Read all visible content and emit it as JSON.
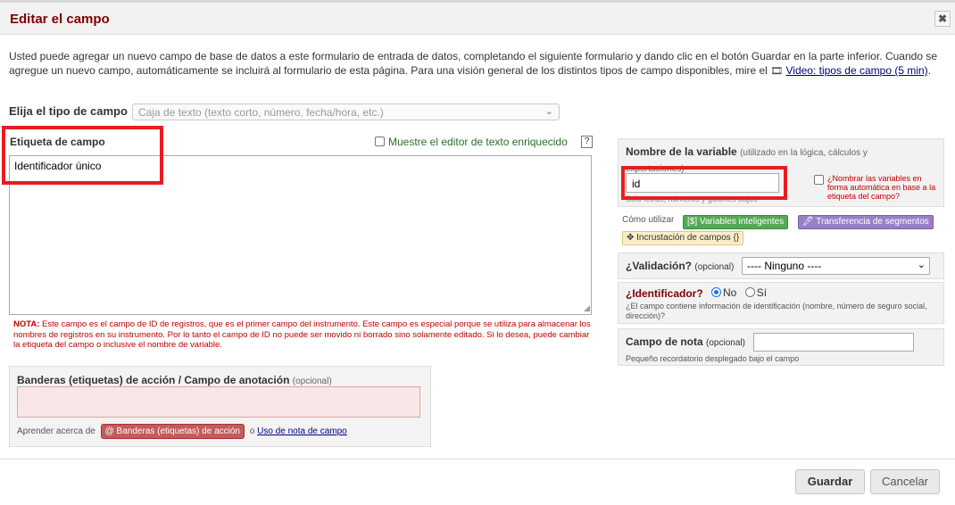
{
  "dialog": {
    "title": "Editar el campo",
    "close_icon": "✖"
  },
  "intro": {
    "text": "Usted puede agregar un nuevo campo de base de datos a este formulario de entrada de datos, completando el siguiente formulario y dando clic en el botón Guardar en la parte inferior. Cuando se agregue un nuevo campo, automáticamente se incluirá al formulario de esta página. Para una visión general de los distintos tipos de campo disponibles, mire el",
    "video_link": "Video: tipos de campo (5 min)",
    "video_icon": "film-icon"
  },
  "field_type": {
    "label": "Elija el tipo de campo",
    "placeholder": "Caja de texto (texto corto, número, fecha/hora, etc.)"
  },
  "field_label": {
    "label": "Etiqueta de campo",
    "value": "Identificador único",
    "rich_text_toggle": "Muestre el editor de texto enriquecido",
    "help": "?"
  },
  "note_warning": {
    "prefix": "NOTA:",
    "text": "Este campo es el campo de ID de registros, que es el primer campo del instrumento. Este campo es especial porque se utiliza para almacenar los nombres de registros en su instrumento. Por lo tanto el campo de ID no puede ser movido ni borrado sino solamente editado. Si lo desea, puede cambiar la etiqueta del campo o inclusive el nombre de variable."
  },
  "action_tags": {
    "title": "Banderas (etiquetas) de acción / Campo de anotación",
    "optional": "(opcional)",
    "learn_prefix": "Aprender acerca de",
    "button": "@ Banderas (etiquetas) de acción",
    "or": "o",
    "link": "Uso de nota de campo"
  },
  "variable": {
    "title": "Nombre de la variable",
    "subtitle": "(utilizado en la lógica, cálculos y exportaciones)",
    "value": "id",
    "hint": "Solo letras, números y guiones bajos",
    "auto_name": "¿Nombrar las variables en forma automática en base a la etiqueta del campo?"
  },
  "how_to": {
    "label": "Cómo utilizar",
    "smart_variables": "[$] Variables inteligentes",
    "piping": "🖊 Transferencia de segmentos",
    "embedding": "✥ Incrustación de campos {}"
  },
  "validation": {
    "label": "¿Validación?",
    "optional": "(opcional)",
    "selected": "---- Ninguno ----"
  },
  "identifier": {
    "label": "¿Identificador?",
    "option_no": "No",
    "option_yes": "Sí",
    "help": "¿El campo contiene información de identificación (nombre, número de seguro social, dirección)?"
  },
  "field_note": {
    "label": "Campo de nota",
    "optional": "(opcional)",
    "help": "Pequeño recordatorio desplegado bajo el campo"
  },
  "footer": {
    "save": "Guardar",
    "cancel": "Cancelar"
  },
  "colors": {
    "title": "#800000",
    "warning": "#c00000",
    "highlight_box": "#e81c23"
  }
}
